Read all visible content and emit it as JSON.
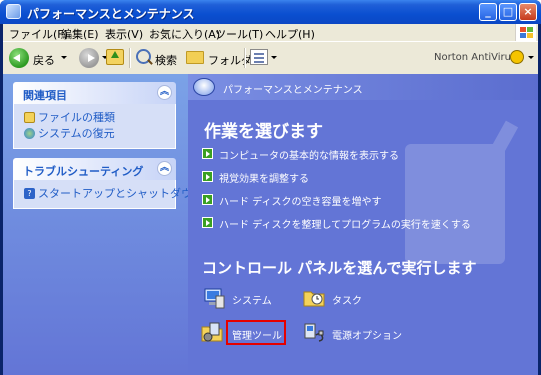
{
  "window": {
    "title": "パフォーマンスとメンテナンス",
    "controls": {
      "minimize": "_",
      "maximize": "□",
      "close": "×"
    }
  },
  "menu": [
    "ファイル(F)",
    "編集(E)",
    "表示(V)",
    "お気に入り(A)",
    "ツール(T)",
    "ヘルプ(H)"
  ],
  "toolbar": {
    "back_label": "戻る",
    "search_label": "検索",
    "folders_label": "フォルダ",
    "norton_label": "Norton AntiVirus"
  },
  "sidebar": {
    "related": {
      "title": "関連項目",
      "items": [
        {
          "label": "ファイルの種類",
          "icon": "file-types-icon"
        },
        {
          "label": "システムの復元",
          "icon": "system-restore-icon"
        }
      ]
    },
    "troubleshoot": {
      "title": "トラブルシューティング",
      "items": [
        {
          "label": "スタートアップとシャットダウン",
          "icon": "help-icon"
        }
      ]
    }
  },
  "main": {
    "header": "パフォーマンスとメンテナンス",
    "pick_task_title": "作業を選びます",
    "tasks": [
      "コンピュータの基本的な情報を表示する",
      "視覚効果を調整する",
      "ハード ディスクの空き容量を増やす",
      "ハード ディスクを整理してプログラムの実行を速くする"
    ],
    "pick_cp_title": "コントロール パネルを選んで実行します",
    "control_panels": [
      {
        "label": "システム",
        "icon": "system-icon"
      },
      {
        "label": "タスク",
        "icon": "scheduled-tasks-icon"
      },
      {
        "label": "管理ツール",
        "icon": "admin-tools-icon"
      },
      {
        "label": "電源オプション",
        "icon": "power-options-icon"
      }
    ]
  },
  "colors": {
    "titlebar": "#0a4fd0",
    "sidebar_link": "#215dc6",
    "main_bg": "#6375d6",
    "highlight": "#e60000"
  }
}
